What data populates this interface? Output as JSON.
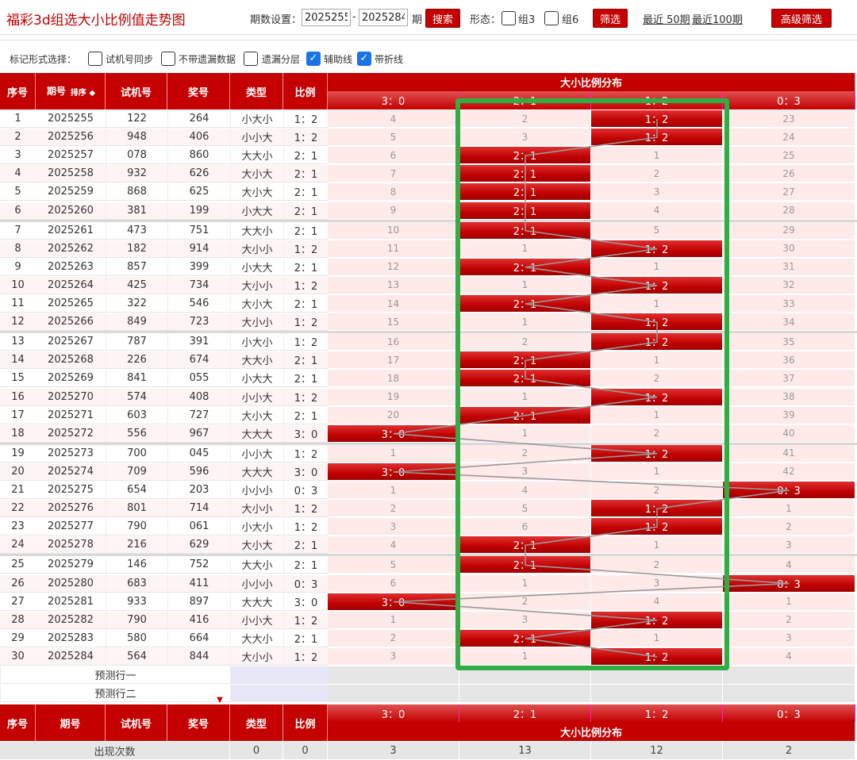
{
  "title": "福彩3d组选大小比例值走势图",
  "toolbar": {
    "period_label": "期数设置：",
    "start_value": "2025255",
    "dash": "-",
    "end_value": "2025284",
    "period_suffix": "期",
    "search_button": "搜索",
    "shape_label": "形态：",
    "group3_label": "组3",
    "group6_label": "组6",
    "filter_button": "筛选",
    "recent50": "最近 50期",
    "recent100": "最近100期",
    "advanced_button": "高级筛选"
  },
  "markbar": {
    "label": "标记形式选择：",
    "options": [
      {
        "label": "试机号同步",
        "checked": false
      },
      {
        "label": "不带遗漏数据",
        "checked": false
      },
      {
        "label": "遗漏分层",
        "checked": false
      },
      {
        "label": "辅助线",
        "checked": true
      },
      {
        "label": "带折线",
        "checked": true
      }
    ]
  },
  "header": {
    "seq": "序号",
    "period": "期号",
    "sort": "排序",
    "trial": "试机号",
    "prize": "奖号",
    "type": "类型",
    "ratio": "比例",
    "dist_title": "大小比例分布",
    "dist_cols": [
      "3：0",
      "2：1",
      "1：2",
      "0：3"
    ]
  },
  "rows": [
    {
      "seq": "1",
      "period": "2025255",
      "trial": "122",
      "prize": "264",
      "type": "小大小",
      "ratio": "1：2",
      "dist": [
        "4",
        "2",
        "1：2",
        "23"
      ],
      "hit": 2
    },
    {
      "seq": "2",
      "period": "2025256",
      "trial": "948",
      "prize": "406",
      "type": "小小大",
      "ratio": "1：2",
      "dist": [
        "5",
        "3",
        "1：2",
        "24"
      ],
      "hit": 2
    },
    {
      "seq": "3",
      "period": "2025257",
      "trial": "078",
      "prize": "860",
      "type": "大大小",
      "ratio": "2：1",
      "dist": [
        "6",
        "2：1",
        "1",
        "25"
      ],
      "hit": 1
    },
    {
      "seq": "4",
      "period": "2025258",
      "trial": "932",
      "prize": "626",
      "type": "大小大",
      "ratio": "2：1",
      "dist": [
        "7",
        "2：1",
        "2",
        "26"
      ],
      "hit": 1
    },
    {
      "seq": "5",
      "period": "2025259",
      "trial": "868",
      "prize": "625",
      "type": "大小大",
      "ratio": "2：1",
      "dist": [
        "8",
        "2：1",
        "3",
        "27"
      ],
      "hit": 1
    },
    {
      "seq": "6",
      "period": "2025260",
      "trial": "381",
      "prize": "199",
      "type": "小大大",
      "ratio": "2：1",
      "dist": [
        "9",
        "2：1",
        "4",
        "28"
      ],
      "hit": 1
    },
    {
      "seq": "7",
      "period": "2025261",
      "trial": "473",
      "prize": "751",
      "type": "大大小",
      "ratio": "2：1",
      "dist": [
        "10",
        "2：1",
        "5",
        "29"
      ],
      "hit": 1
    },
    {
      "seq": "8",
      "period": "2025262",
      "trial": "182",
      "prize": "914",
      "type": "大小小",
      "ratio": "1：2",
      "dist": [
        "11",
        "1",
        "1：2",
        "30"
      ],
      "hit": 2
    },
    {
      "seq": "9",
      "period": "2025263",
      "trial": "857",
      "prize": "399",
      "type": "小大大",
      "ratio": "2：1",
      "dist": [
        "12",
        "2：1",
        "1",
        "31"
      ],
      "hit": 1
    },
    {
      "seq": "10",
      "period": "2025264",
      "trial": "425",
      "prize": "734",
      "type": "大小小",
      "ratio": "1：2",
      "dist": [
        "13",
        "1",
        "1：2",
        "32"
      ],
      "hit": 2
    },
    {
      "seq": "11",
      "period": "2025265",
      "trial": "322",
      "prize": "546",
      "type": "大小大",
      "ratio": "2：1",
      "dist": [
        "14",
        "2：1",
        "1",
        "33"
      ],
      "hit": 1
    },
    {
      "seq": "12",
      "period": "2025266",
      "trial": "849",
      "prize": "723",
      "type": "大小小",
      "ratio": "1：2",
      "dist": [
        "15",
        "1",
        "1：2",
        "34"
      ],
      "hit": 2
    },
    {
      "seq": "13",
      "period": "2025267",
      "trial": "787",
      "prize": "391",
      "type": "小大小",
      "ratio": "1：2",
      "dist": [
        "16",
        "2",
        "1：2",
        "35"
      ],
      "hit": 2
    },
    {
      "seq": "14",
      "period": "2025268",
      "trial": "226",
      "prize": "674",
      "type": "大大小",
      "ratio": "2：1",
      "dist": [
        "17",
        "2：1",
        "1",
        "36"
      ],
      "hit": 1
    },
    {
      "seq": "15",
      "period": "2025269",
      "trial": "841",
      "prize": "055",
      "type": "小大大",
      "ratio": "2：1",
      "dist": [
        "18",
        "2：1",
        "2",
        "37"
      ],
      "hit": 1
    },
    {
      "seq": "16",
      "period": "2025270",
      "trial": "574",
      "prize": "408",
      "type": "小小大",
      "ratio": "1：2",
      "dist": [
        "19",
        "1",
        "1：2",
        "38"
      ],
      "hit": 2
    },
    {
      "seq": "17",
      "period": "2025271",
      "trial": "603",
      "prize": "727",
      "type": "大小大",
      "ratio": "2：1",
      "dist": [
        "20",
        "2：1",
        "1",
        "39"
      ],
      "hit": 1
    },
    {
      "seq": "18",
      "period": "2025272",
      "trial": "556",
      "prize": "967",
      "type": "大大大",
      "ratio": "3：0",
      "dist": [
        "3：0",
        "1",
        "2",
        "40"
      ],
      "hit": 0
    },
    {
      "seq": "19",
      "period": "2025273",
      "trial": "700",
      "prize": "045",
      "type": "小小大",
      "ratio": "1：2",
      "dist": [
        "1",
        "2",
        "1：2",
        "41"
      ],
      "hit": 2
    },
    {
      "seq": "20",
      "period": "2025274",
      "trial": "709",
      "prize": "596",
      "type": "大大大",
      "ratio": "3：0",
      "dist": [
        "3：0",
        "3",
        "1",
        "42"
      ],
      "hit": 0
    },
    {
      "seq": "21",
      "period": "2025275",
      "trial": "654",
      "prize": "203",
      "type": "小小小",
      "ratio": "0：3",
      "dist": [
        "1",
        "4",
        "2",
        "0：3"
      ],
      "hit": 3
    },
    {
      "seq": "22",
      "period": "2025276",
      "trial": "801",
      "prize": "714",
      "type": "大小小",
      "ratio": "1：2",
      "dist": [
        "2",
        "5",
        "1：2",
        "1"
      ],
      "hit": 2
    },
    {
      "seq": "23",
      "period": "2025277",
      "trial": "790",
      "prize": "061",
      "type": "小大小",
      "ratio": "1：2",
      "dist": [
        "3",
        "6",
        "1：2",
        "2"
      ],
      "hit": 2
    },
    {
      "seq": "24",
      "period": "2025278",
      "trial": "216",
      "prize": "629",
      "type": "大小大",
      "ratio": "2：1",
      "dist": [
        "4",
        "2：1",
        "1",
        "3"
      ],
      "hit": 1
    },
    {
      "seq": "25",
      "period": "2025279",
      "trial": "146",
      "prize": "752",
      "type": "大大小",
      "ratio": "2：1",
      "dist": [
        "5",
        "2：1",
        "2",
        "4"
      ],
      "hit": 1
    },
    {
      "seq": "26",
      "period": "2025280",
      "trial": "683",
      "prize": "411",
      "type": "小小小",
      "ratio": "0：3",
      "dist": [
        "6",
        "1",
        "3",
        "0：3"
      ],
      "hit": 3
    },
    {
      "seq": "27",
      "period": "2025281",
      "trial": "933",
      "prize": "897",
      "type": "大大大",
      "ratio": "3：0",
      "dist": [
        "3：0",
        "2",
        "4",
        "1"
      ],
      "hit": 0
    },
    {
      "seq": "28",
      "period": "2025282",
      "trial": "790",
      "prize": "416",
      "type": "小小大",
      "ratio": "1：2",
      "dist": [
        "1",
        "3",
        "1：2",
        "2"
      ],
      "hit": 2
    },
    {
      "seq": "29",
      "period": "2025283",
      "trial": "580",
      "prize": "664",
      "type": "大大小",
      "ratio": "2：1",
      "dist": [
        "2",
        "2：1",
        "1",
        "3"
      ],
      "hit": 1
    },
    {
      "seq": "30",
      "period": "2025284",
      "trial": "564",
      "prize": "844",
      "type": "大小小",
      "ratio": "1：2",
      "dist": [
        "3",
        "1",
        "1：2",
        "4"
      ],
      "hit": 2
    }
  ],
  "predict": [
    "预测行一",
    "预测行二"
  ],
  "footer_stats": {
    "label": "出现次数",
    "type_count": "0",
    "ratio_count": "0",
    "dist_counts": [
      "3",
      "13",
      "12",
      "2"
    ]
  },
  "colors": {
    "brand_red": "#c40000",
    "highlight_green": "#2fae44",
    "checkbox_blue": "#1a73e8"
  }
}
